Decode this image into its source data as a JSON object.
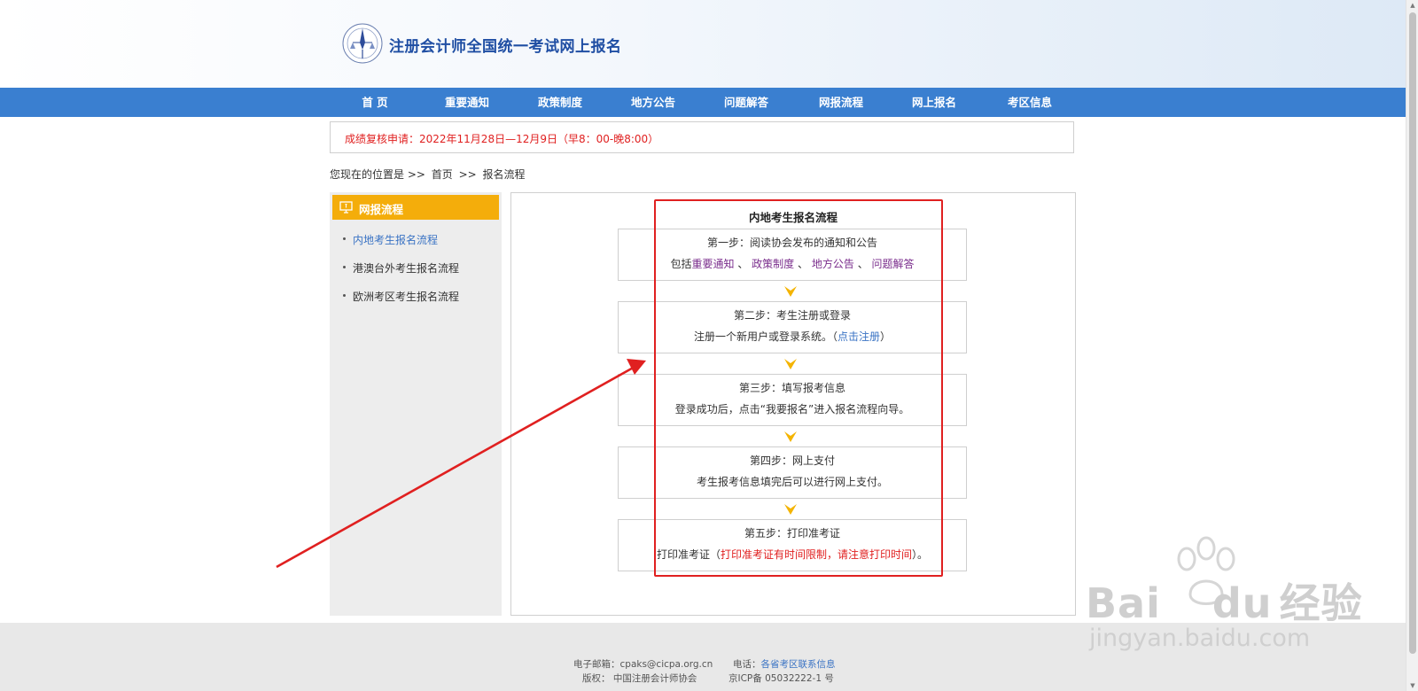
{
  "header": {
    "title": "注册会计师全国统一考试网上报名"
  },
  "nav": {
    "items": [
      {
        "label": "首  页"
      },
      {
        "label": "重要通知"
      },
      {
        "label": "政策制度"
      },
      {
        "label": "地方公告"
      },
      {
        "label": "问题解答"
      },
      {
        "label": "网报流程"
      },
      {
        "label": "网上报名"
      },
      {
        "label": "考区信息"
      }
    ]
  },
  "notice": {
    "text": "成绩复核申请：2022年11月28日—12月9日（早8：00-晚8:00）"
  },
  "breadcrumb": {
    "prefix": "您现在的位置是 >>",
    "home": "首页",
    "sep": ">>",
    "current": "报名流程"
  },
  "sidebar": {
    "title": "网报流程",
    "items": [
      {
        "label": "内地考生报名流程"
      },
      {
        "label": "港澳台外考生报名流程"
      },
      {
        "label": "欧洲考区考生报名流程"
      }
    ]
  },
  "flow": {
    "title": "内地考生报名流程",
    "step1": {
      "title": "第一步：阅读协会发布的通知和公告",
      "prefix": "包括",
      "link1": "重要通知",
      "sep1": "、",
      "link2": "政策制度",
      "sep2": "、",
      "link3": "地方公告",
      "sep3": "、",
      "link4": "问题解答"
    },
    "step2": {
      "title": "第二步：考生注册或登录",
      "desc": "注册一个新用户或登录系统。（",
      "link": "点击注册",
      "suffix": "）"
    },
    "step3": {
      "title": "第三步：填写报考信息",
      "desc": "登录成功后，点击“我要报名”进入报名流程向导。"
    },
    "step4": {
      "title": "第四步：网上支付",
      "desc": "考生报考信息填完后可以进行网上支付。"
    },
    "step5": {
      "title": "第五步：打印准考证",
      "prefix": "打印准考证（",
      "warn": "打印准考证有时间限制，请注意打印时间",
      "suffix": "）。"
    }
  },
  "footer": {
    "email": "电子邮箱：cpaks@cicpa.org.cn",
    "copyright": "版权： 中国注册会计师协会",
    "phone_label": "电话：",
    "phone_link": "各省考区联系信息",
    "icp": "京ICP备 05032222-1 号"
  },
  "watermark": {
    "brand": "Bai",
    "brand2": "du",
    "brand3": "经验",
    "url": "jingyan.baidu.com"
  },
  "colors": {
    "nav": "#3a7fd0",
    "sidebar_head": "#f4ad0b",
    "highlight": "#e02020",
    "link_purple": "#7a2d8c",
    "link_blue": "#3a73c4",
    "arrow": "#f4b400"
  }
}
